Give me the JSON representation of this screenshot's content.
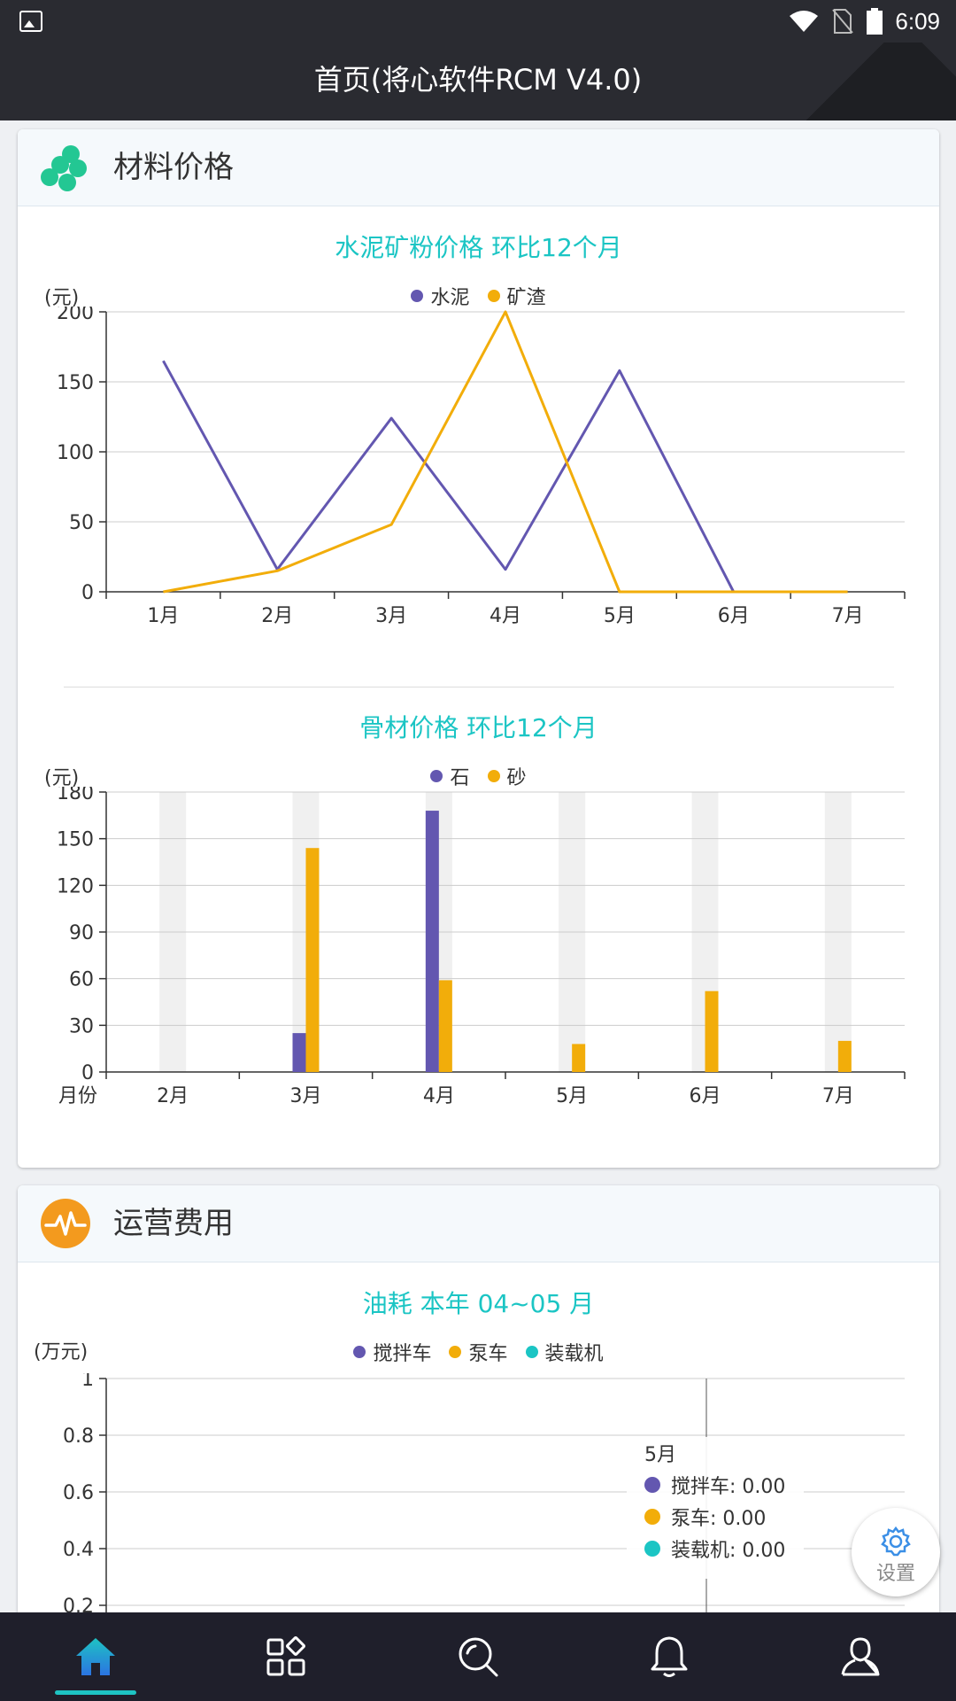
{
  "status_bar": {
    "time": "6:09"
  },
  "app_bar": {
    "title": "首页(将心软件RCM V4.0)"
  },
  "colors": {
    "purple": "#6357b0",
    "orange": "#f2ad0a",
    "teal": "#1bc5c4"
  },
  "materials_card": {
    "header": "材料价格",
    "icon": "materials-cluster-icon",
    "cement_chart_title": "水泥矿粉价格 环比12个月",
    "cement_unit": "(元)",
    "aggregate_chart_title": "骨材价格 环比12个月",
    "aggregate_unit": "(元)"
  },
  "operations_card": {
    "header": "运营费用",
    "icon": "pulse-icon",
    "fuel_chart_title": "油耗 本年 04~05 月",
    "fuel_unit": "(万元)"
  },
  "chart_data": [
    {
      "type": "line",
      "title": "水泥矿粉价格 环比12个月",
      "ylabel": "(元)",
      "categories": [
        "1月",
        "2月",
        "3月",
        "4月",
        "5月",
        "6月",
        "7月"
      ],
      "series": [
        {
          "name": "水泥",
          "color": "#6357b0",
          "values": [
            165,
            16,
            124,
            16,
            158,
            0,
            0
          ]
        },
        {
          "name": "矿渣",
          "color": "#f2ad0a",
          "values": [
            0,
            15,
            48,
            200,
            0,
            0,
            0
          ]
        }
      ],
      "ylim": [
        0,
        200
      ],
      "yticks": [
        0,
        50,
        100,
        150,
        200
      ],
      "grid": true,
      "legend": "top-center"
    },
    {
      "type": "bar",
      "title": "骨材价格 环比12个月",
      "ylabel": "(元)",
      "xlabel": "月份",
      "categories": [
        "2月",
        "3月",
        "4月",
        "5月",
        "6月",
        "7月"
      ],
      "series": [
        {
          "name": "石",
          "color": "#6357b0",
          "values": [
            0,
            25,
            168,
            0,
            0,
            0
          ]
        },
        {
          "name": "砂",
          "color": "#f2ad0a",
          "values": [
            0,
            144,
            59,
            18,
            52,
            20
          ]
        }
      ],
      "ylim": [
        0,
        180
      ],
      "yticks": [
        0,
        30,
        60,
        90,
        120,
        150,
        180
      ],
      "grid": true,
      "legend": "top-center"
    },
    {
      "type": "line",
      "title": "油耗 本年 04~05 月",
      "ylabel": "(万元)",
      "series": [
        {
          "name": "搅拌车",
          "color": "#6357b0",
          "values": [
            0,
            0
          ]
        },
        {
          "name": "泵车",
          "color": "#f2ad0a",
          "values": [
            0,
            0
          ]
        },
        {
          "name": "装载机",
          "color": "#1bc5c4",
          "values": [
            0,
            0
          ]
        }
      ],
      "ylim": [
        0,
        1
      ],
      "yticks_visible": [
        "1",
        "0.8",
        "0.6",
        "0.4",
        "0.2"
      ],
      "grid": true,
      "legend": "top-center",
      "tooltip": {
        "title": "5月",
        "rows": [
          "搅拌车: 0.00",
          "泵车: 0.00",
          "装载机: 0.00"
        ]
      }
    }
  ],
  "settings_fab": {
    "label": "设置",
    "icon": "gear-icon"
  },
  "bottom_nav": [
    {
      "name": "home",
      "icon": "home-icon",
      "active": true
    },
    {
      "name": "apps",
      "icon": "apps-grid-icon",
      "active": false
    },
    {
      "name": "search",
      "icon": "search-icon",
      "active": false
    },
    {
      "name": "notifications",
      "icon": "bell-icon",
      "active": false
    },
    {
      "name": "profile",
      "icon": "user-icon",
      "active": false
    }
  ]
}
